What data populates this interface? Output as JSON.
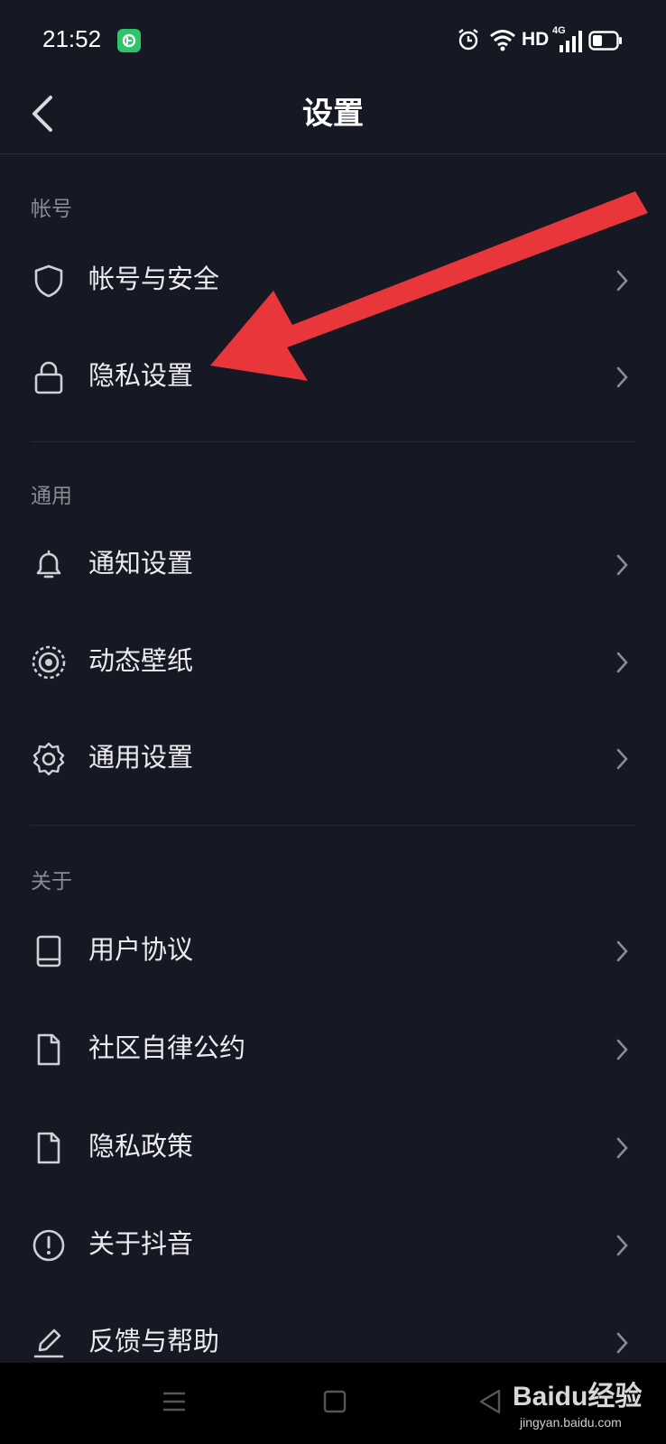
{
  "status_bar": {
    "time": "21:52",
    "network_type": "4G",
    "hd_label": "HD",
    "icons": [
      "alarm-icon",
      "wifi-icon",
      "signal-icon",
      "battery-icon"
    ]
  },
  "header": {
    "title": "设置",
    "back_icon": "chevron-left-icon"
  },
  "sections": [
    {
      "header": "帐号",
      "items": [
        {
          "label": "帐号与安全",
          "icon": "shield-icon"
        },
        {
          "label": "隐私设置",
          "icon": "lock-icon"
        }
      ]
    },
    {
      "header": "通用",
      "items": [
        {
          "label": "通知设置",
          "icon": "bell-icon"
        },
        {
          "label": "动态壁纸",
          "icon": "live-wallpaper-icon"
        },
        {
          "label": "通用设置",
          "icon": "gear-icon"
        }
      ]
    },
    {
      "header": "关于",
      "items": [
        {
          "label": "用户协议",
          "icon": "book-icon"
        },
        {
          "label": "社区自律公约",
          "icon": "document-icon"
        },
        {
          "label": "隐私政策",
          "icon": "document-icon"
        },
        {
          "label": "关于抖音",
          "icon": "info-icon"
        },
        {
          "label": "反馈与帮助",
          "icon": "pencil-icon"
        }
      ]
    }
  ],
  "annotation": {
    "type": "red-arrow",
    "color": "#e8363a",
    "points_to": "隐私设置"
  },
  "system_nav": {
    "buttons": [
      "menu-icon",
      "home-icon",
      "back-triangle-icon"
    ]
  },
  "watermark": {
    "main": "Baidu经验",
    "sub": "jingyan.baidu.com"
  },
  "colors": {
    "background": "#161823",
    "text": "#ececf0",
    "section_header": "#8a8b94",
    "divider": "#262833"
  }
}
